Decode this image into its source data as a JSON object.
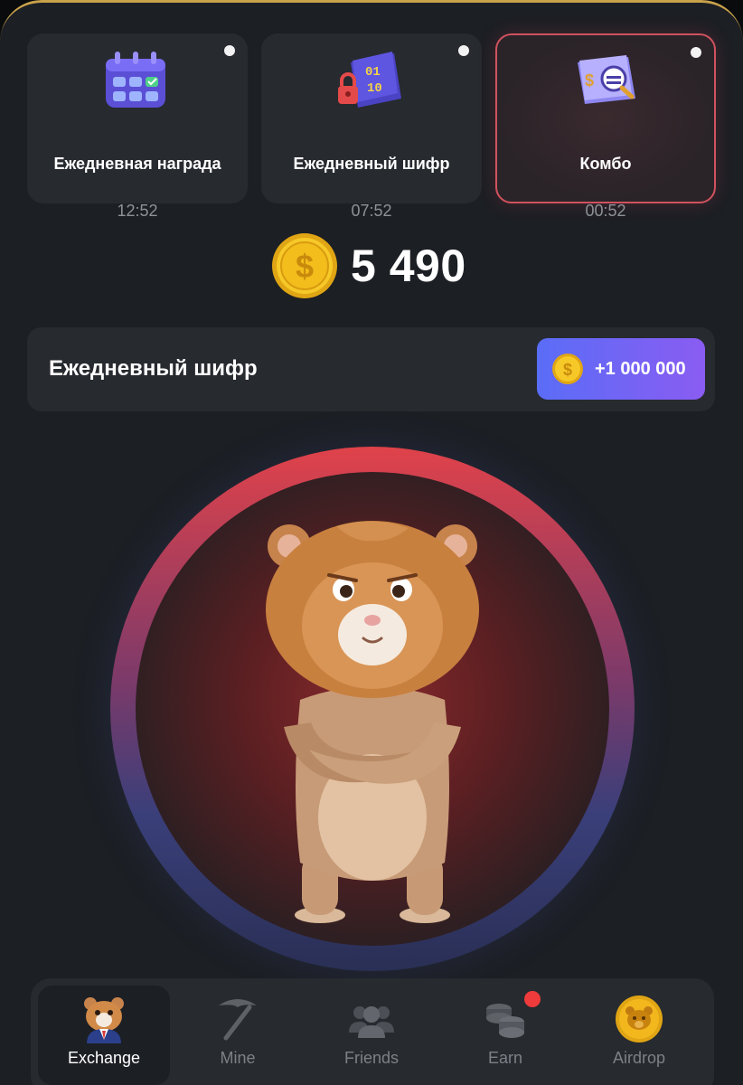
{
  "daily_cards": [
    {
      "title": "Ежедневная награда",
      "timer": "12:52",
      "icon": "calendar-icon"
    },
    {
      "title": "Ежедневный шифр",
      "timer": "07:52",
      "icon": "cipher-lock-icon"
    },
    {
      "title": "Комбо",
      "timer": "00:52",
      "icon": "combo-card-icon"
    }
  ],
  "balance": {
    "amount": "5 490",
    "icon": "coin-icon"
  },
  "cipher_bar": {
    "title": "Ежедневный шифр",
    "reward": "+1 000 000"
  },
  "tap_area": {
    "character": "hamster"
  },
  "nav": {
    "items": [
      {
        "label": "Exchange",
        "icon": "hamster-ceo-icon",
        "active": true
      },
      {
        "label": "Mine",
        "icon": "pickaxe-icon",
        "active": false
      },
      {
        "label": "Friends",
        "icon": "friends-icon",
        "active": false
      },
      {
        "label": "Earn",
        "icon": "coins-stack-icon",
        "active": false,
        "badge": true
      },
      {
        "label": "Airdrop",
        "icon": "airdrop-coin-icon",
        "active": false
      }
    ]
  },
  "colors": {
    "background": "#1c1f24",
    "card": "#272a2f",
    "accent_red": "#d0525e",
    "button_gradient_start": "#5a6df7",
    "button_gradient_end": "#8a5cf2",
    "coin_gold": "#f3c21b",
    "muted_text": "#8e9298"
  }
}
